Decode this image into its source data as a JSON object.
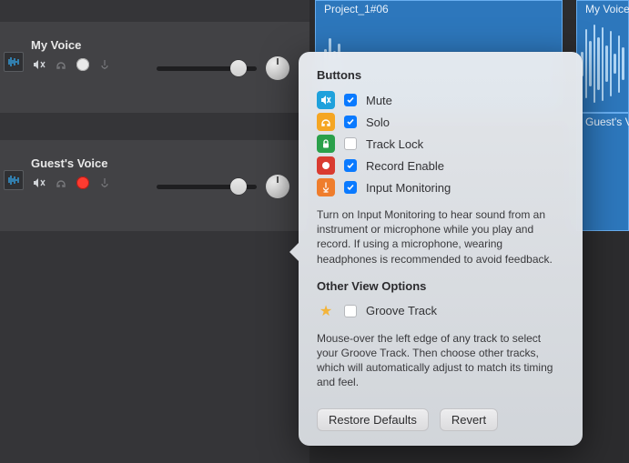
{
  "tracks": [
    {
      "name": "My Voice",
      "record_color": "white",
      "mute": true,
      "solo": false,
      "monitor": false,
      "volume": 0.82
    },
    {
      "name": "Guest's Voice",
      "record_color": "red",
      "mute": true,
      "solo": false,
      "monitor": false,
      "volume": 0.82
    }
  ],
  "clips": [
    {
      "label": "Project_1#06"
    },
    {
      "label": "My Voice#"
    },
    {
      "label": "Guest's Vo"
    }
  ],
  "popover": {
    "section1_title": "Buttons",
    "options": [
      {
        "label": "Mute",
        "checked": true,
        "icon": "mute",
        "color": "i-blue"
      },
      {
        "label": "Solo",
        "checked": true,
        "icon": "headphones",
        "color": "i-amber"
      },
      {
        "label": "Track Lock",
        "checked": false,
        "icon": "lock",
        "color": "i-green"
      },
      {
        "label": "Record Enable",
        "checked": true,
        "icon": "record",
        "color": "i-red"
      },
      {
        "label": "Input Monitoring",
        "checked": true,
        "icon": "monitor",
        "color": "i-orange"
      }
    ],
    "hint1": "Turn on Input Monitoring to hear sound from an instrument or microphone while you play and record. If using a microphone, wearing headphones is recommended to avoid feedback.",
    "section2_title": "Other View Options",
    "groove": {
      "label": "Groove Track",
      "checked": false
    },
    "hint2": "Mouse-over the left edge of any track to select your Groove Track. Then choose other tracks, which will automatically adjust to match its timing and feel.",
    "restore_label": "Restore Defaults",
    "revert_label": "Revert"
  },
  "icons": {
    "mute": "M",
    "headphones": "H",
    "lock": "L",
    "record": "R",
    "monitor": "I",
    "star": "★"
  }
}
